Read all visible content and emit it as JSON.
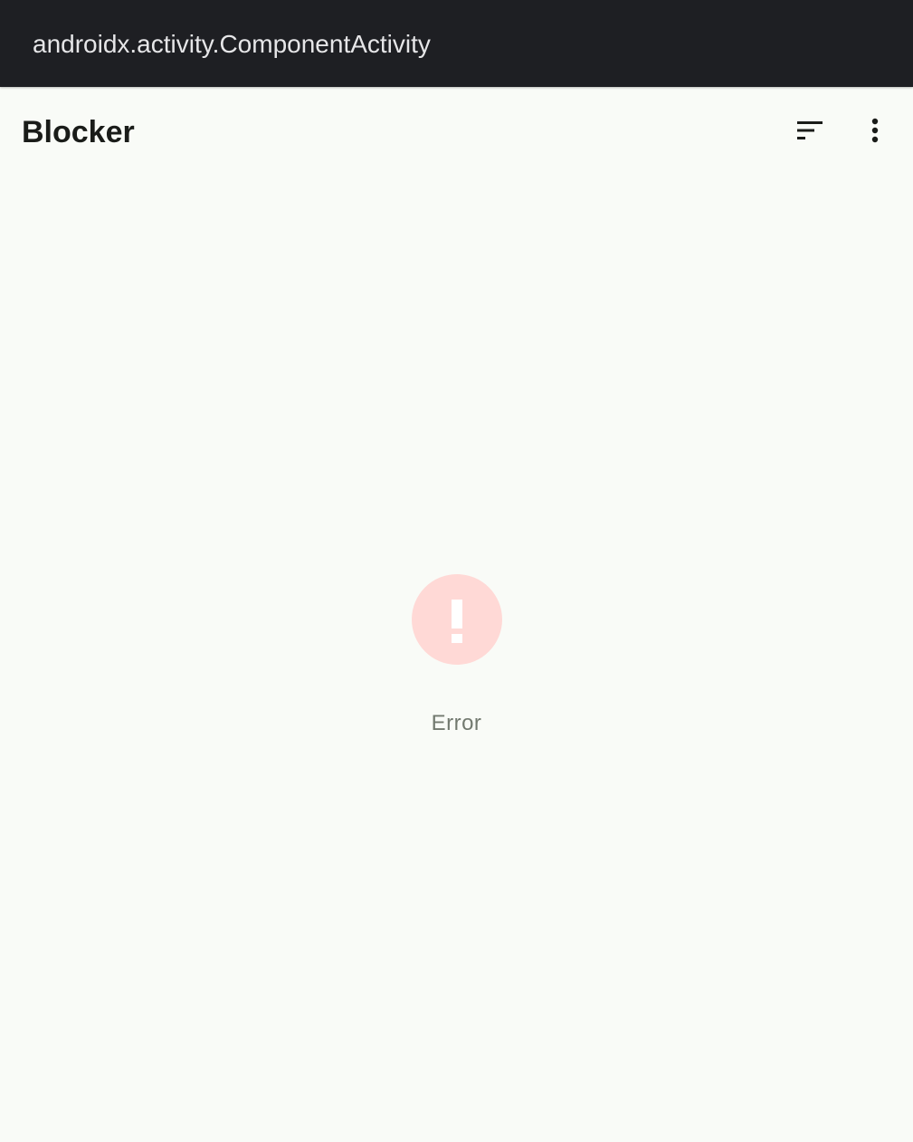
{
  "window": {
    "title": "androidx.activity.ComponentActivity"
  },
  "app_bar": {
    "title": "Blocker",
    "actions": [
      {
        "icon": "sort-icon"
      },
      {
        "icon": "more-vert-icon"
      }
    ]
  },
  "error_state": {
    "icon": "error-icon",
    "message": "Error"
  },
  "colors": {
    "titlebar_bg": "#1e1f23",
    "page_bg": "#f9fbf7",
    "error_icon_bg": "#ffd9d6",
    "error_text": "#72796f"
  }
}
